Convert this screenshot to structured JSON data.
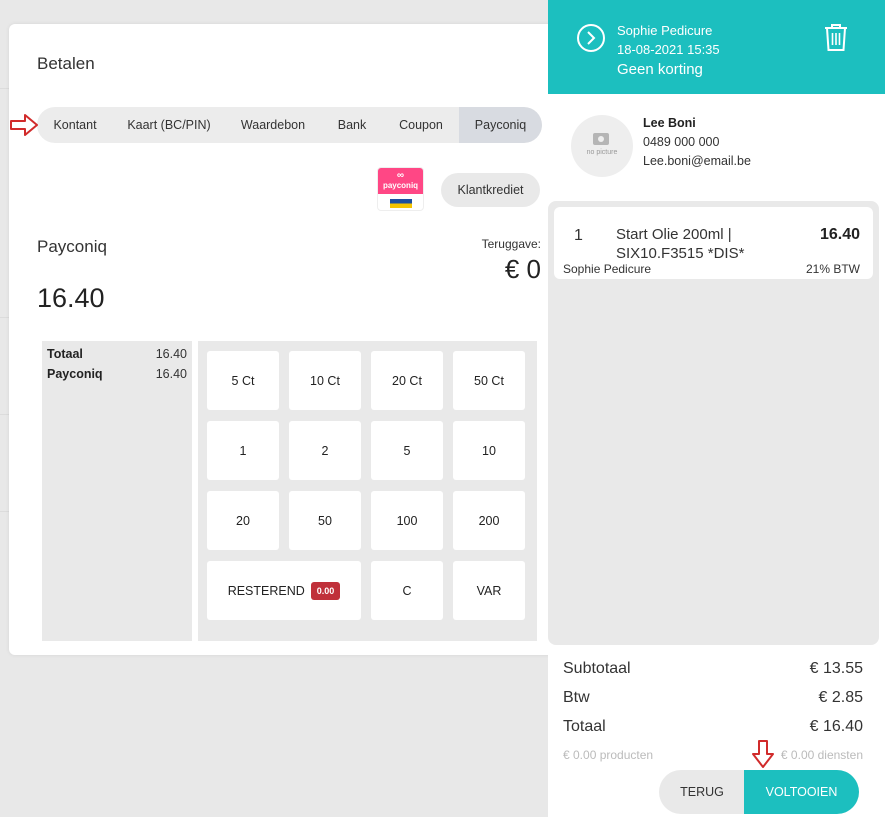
{
  "modal": {
    "title": "Betalen",
    "tabs": [
      "Kontant",
      "Kaart (BC/PIN)",
      "Waardebon",
      "Bank",
      "Coupon",
      "Payconiq"
    ],
    "active_tab": "Payconiq",
    "logo_text": "payconiq",
    "krediet_label": "Klantkrediet",
    "method_label": "Payconiq",
    "terug_label": "Teruggave:",
    "terug_value": "€ 0",
    "amount": "16.40",
    "summary": [
      {
        "label": "Totaal",
        "value": "16.40"
      },
      {
        "label": "Payconiq",
        "value": "16.40"
      }
    ],
    "keypad": {
      "k5ct": "5 Ct",
      "k10ct": "10 Ct",
      "k20ct": "20 Ct",
      "k50ct": "50 Ct",
      "k1": "1",
      "k2": "2",
      "k5": "5",
      "k10": "10",
      "k20": "20",
      "k50": "50",
      "k100": "100",
      "k200": "200",
      "resterend": "RESTEREND",
      "resterend_badge": "0.00",
      "clear": "C",
      "var": "VAR"
    }
  },
  "header": {
    "employee": "Sophie Pedicure",
    "datetime": "18-08-2021 15:35",
    "discount": "Geen korting"
  },
  "customer": {
    "no_picture": "no picture",
    "name": "Lee Boni",
    "phone": "0489 000 000",
    "email": "Lee.boni@email.be"
  },
  "cart": {
    "item": {
      "qty": "1",
      "name": "Start Olie 200ml | SIX10.F3515 *DIS*",
      "price": "16.40",
      "employee": "Sophie Pedicure",
      "vat": "21% BTW"
    }
  },
  "totals": {
    "subtotal_label": "Subtotaal",
    "subtotal": "€ 13.55",
    "btw_label": "Btw",
    "btw": "€ 2.85",
    "total_label": "Totaal",
    "total": "€ 16.40",
    "products": "€ 0.00 producten",
    "services": "€ 0.00 diensten"
  },
  "actions": {
    "back": "TERUG",
    "complete": "VOLTOOIEN"
  },
  "colors": {
    "accent": "#1cbfbf",
    "badge": "#c0303a",
    "annotation_arrow": "#d12b2b"
  }
}
